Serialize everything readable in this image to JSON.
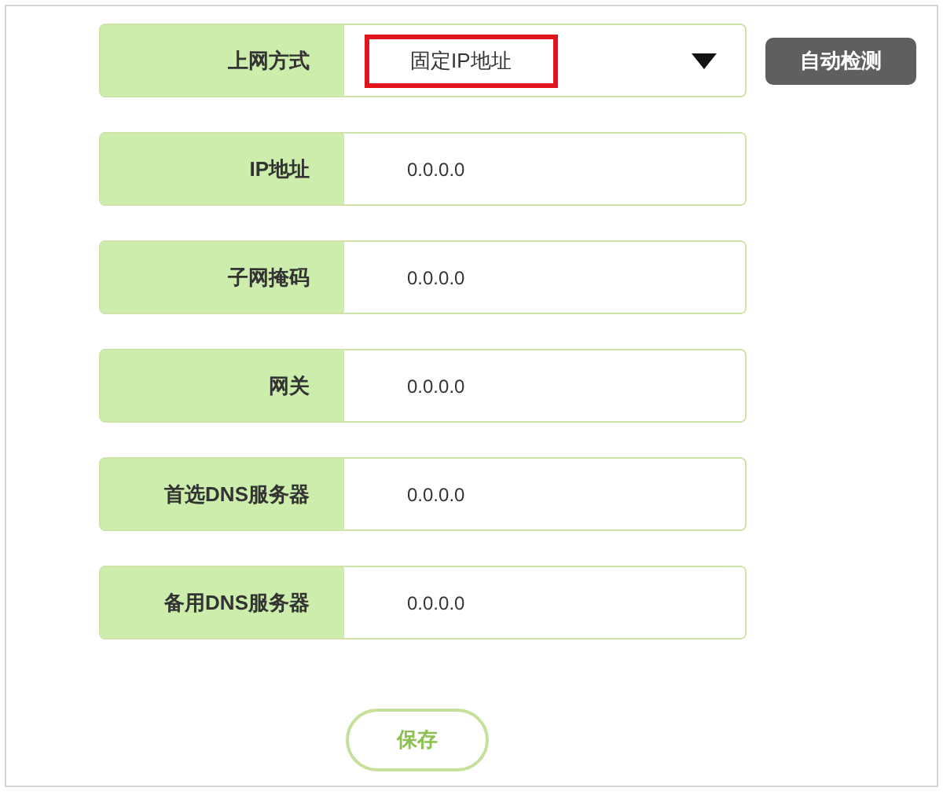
{
  "fields": [
    {
      "kind": "select",
      "label": "上网方式",
      "value": "固定IP地址",
      "highlighted": true
    },
    {
      "kind": "text",
      "label": "IP地址",
      "value": "0.0.0.0"
    },
    {
      "kind": "text",
      "label": "子网掩码",
      "value": "0.0.0.0"
    },
    {
      "kind": "text",
      "label": "网关",
      "value": "0.0.0.0"
    },
    {
      "kind": "text",
      "label": "首选DNS服务器",
      "value": "0.0.0.0"
    },
    {
      "kind": "text",
      "label": "备用DNS服务器",
      "value": "0.0.0.0"
    }
  ],
  "detect_button": "自动检测",
  "save_button": "保存"
}
